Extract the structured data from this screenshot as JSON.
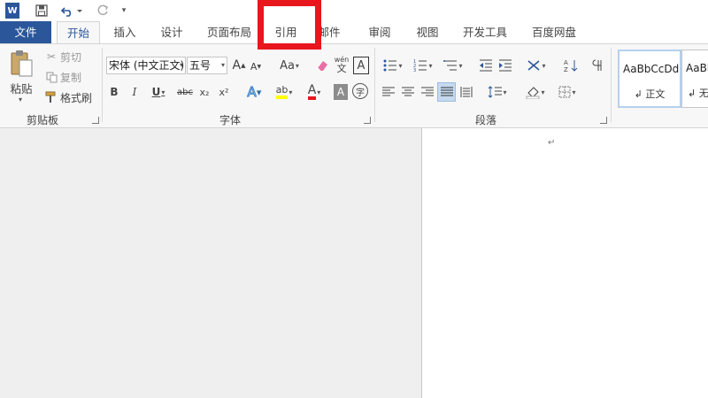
{
  "qat": {
    "word_icon": "W",
    "save_icon": "save-icon",
    "undo_icon": "undo-icon",
    "redo_icon": "redo-icon",
    "customize_icon": "customize-icon"
  },
  "tabs": [
    {
      "label": "文件"
    },
    {
      "label": "开始"
    },
    {
      "label": "插入"
    },
    {
      "label": "设计"
    },
    {
      "label": "页面布局"
    },
    {
      "label": "引用"
    },
    {
      "label": "邮件"
    },
    {
      "label": "审阅"
    },
    {
      "label": "视图"
    },
    {
      "label": "开发工具"
    },
    {
      "label": "百度网盘"
    }
  ],
  "clipboard": {
    "paste": "粘贴",
    "cut": "剪切",
    "copy": "复制",
    "format_painter": "格式刷",
    "group": "剪贴板"
  },
  "font": {
    "name": "宋体 (中文正文)",
    "size": "五号",
    "group": "字体",
    "bold": "B",
    "italic": "I",
    "underline": "U",
    "strike": "abc",
    "subscript": "x₂",
    "superscript": "x²",
    "grow": "A",
    "shrink": "A",
    "case": "Aa",
    "phonetic_top": "wén",
    "phonetic_bottom": "文",
    "border_char": "A",
    "effects": "A",
    "highlight": "ab",
    "font_color": "A",
    "shading": "A",
    "enclose": "字"
  },
  "paragraph": {
    "group": "段落"
  },
  "styles": [
    {
      "preview": "AaBbCcDd",
      "name": "↲ 正文"
    },
    {
      "preview": "AaBl",
      "name": "↲ 无"
    }
  ],
  "document": {
    "para_mark": "↵"
  },
  "colors": {
    "accent": "#2b579a",
    "highlight_box": "#e8161d",
    "highlight_yellow": "#ffff00",
    "font_red": "#e8161d"
  }
}
